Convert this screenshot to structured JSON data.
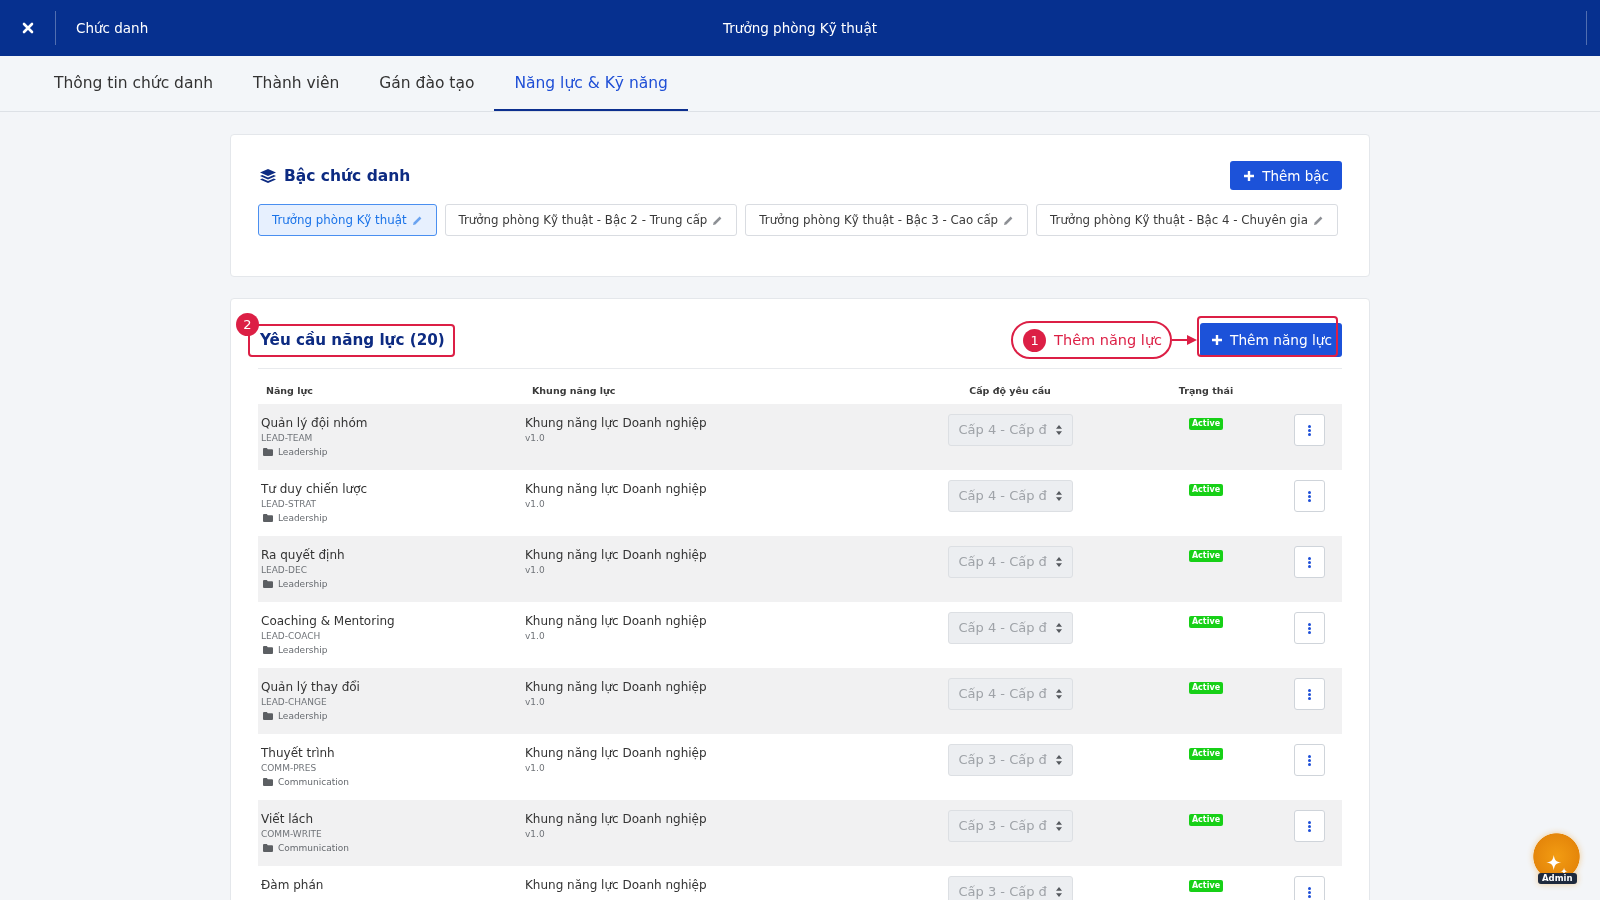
{
  "header": {
    "section_label": "Chức danh",
    "title": "Trưởng phòng Kỹ thuật"
  },
  "tabs": [
    {
      "label": "Thông tin chức danh",
      "selected": false
    },
    {
      "label": "Thành viên",
      "selected": false
    },
    {
      "label": "Gán đào tạo",
      "selected": false
    },
    {
      "label": "Năng lực & Kỹ năng",
      "selected": true
    }
  ],
  "levels": {
    "title": "Bậc chức danh",
    "add_button": "Thêm bậc",
    "items": [
      {
        "label": "Trưởng phòng Kỹ thuật",
        "selected": true
      },
      {
        "label": "Trưởng phòng Kỹ thuật - Bậc 2 - Trung cấp",
        "selected": false
      },
      {
        "label": "Trưởng phòng Kỹ thuật - Bậc 3 - Cao cấp",
        "selected": false
      },
      {
        "label": "Trưởng phòng Kỹ thuật - Bậc 4 - Chuyên gia",
        "selected": false
      }
    ]
  },
  "requirements": {
    "title": "Yêu cầu năng lực (20)",
    "title_callout": "2",
    "add_button": "Thêm năng lực",
    "add_callout": {
      "number": "1",
      "text": "Thêm năng lực"
    },
    "columns": [
      "Năng lực",
      "Khung năng lực",
      "Cấp độ yêu cầu",
      "Trạng thái"
    ],
    "rows": [
      {
        "name": "Quản lý đội nhóm",
        "code": "LEAD-TEAM",
        "category": "Leadership",
        "framework": "Khung năng lực Doanh nghiệp",
        "version": "v1.0",
        "level": "Cấp 4 - Cấp đ",
        "level_disabled": true,
        "status": "Active"
      },
      {
        "name": "Tư duy chiến lược",
        "code": "LEAD-STRAT",
        "category": "Leadership",
        "framework": "Khung năng lực Doanh nghiệp",
        "version": "v1.0",
        "level": "Cấp 4 - Cấp đ",
        "level_disabled": true,
        "status": "Active"
      },
      {
        "name": "Ra quyết định",
        "code": "LEAD-DEC",
        "category": "Leadership",
        "framework": "Khung năng lực Doanh nghiệp",
        "version": "v1.0",
        "level": "Cấp 4 - Cấp đ",
        "level_disabled": true,
        "status": "Active"
      },
      {
        "name": "Coaching & Mentoring",
        "code": "LEAD-COACH",
        "category": "Leadership",
        "framework": "Khung năng lực Doanh nghiệp",
        "version": "v1.0",
        "level": "Cấp 4 - Cấp đ",
        "level_disabled": true,
        "status": "Active"
      },
      {
        "name": "Quản lý thay đổi",
        "code": "LEAD-CHANGE",
        "category": "Leadership",
        "framework": "Khung năng lực Doanh nghiệp",
        "version": "v1.0",
        "level": "Cấp 4 - Cấp đ",
        "level_disabled": true,
        "status": "Active"
      },
      {
        "name": "Thuyết trình",
        "code": "COMM-PRES",
        "category": "Communication",
        "framework": "Khung năng lực Doanh nghiệp",
        "version": "v1.0",
        "level": "Cấp 3 - Cấp đ",
        "level_disabled": true,
        "status": "Active"
      },
      {
        "name": "Viết lách",
        "code": "COMM-WRITE",
        "category": "Communication",
        "framework": "Khung năng lực Doanh nghiệp",
        "version": "v1.0",
        "level": "Cấp 3 - Cấp đ",
        "level_disabled": true,
        "status": "Active"
      },
      {
        "name": "Đàm phán",
        "framework": "Khung năng lực Doanh nghiệp",
        "level": "Cấp 3 - Cấp đ",
        "level_disabled": true,
        "status": "Active"
      }
    ]
  },
  "assistant": {
    "label": "Admin"
  }
}
